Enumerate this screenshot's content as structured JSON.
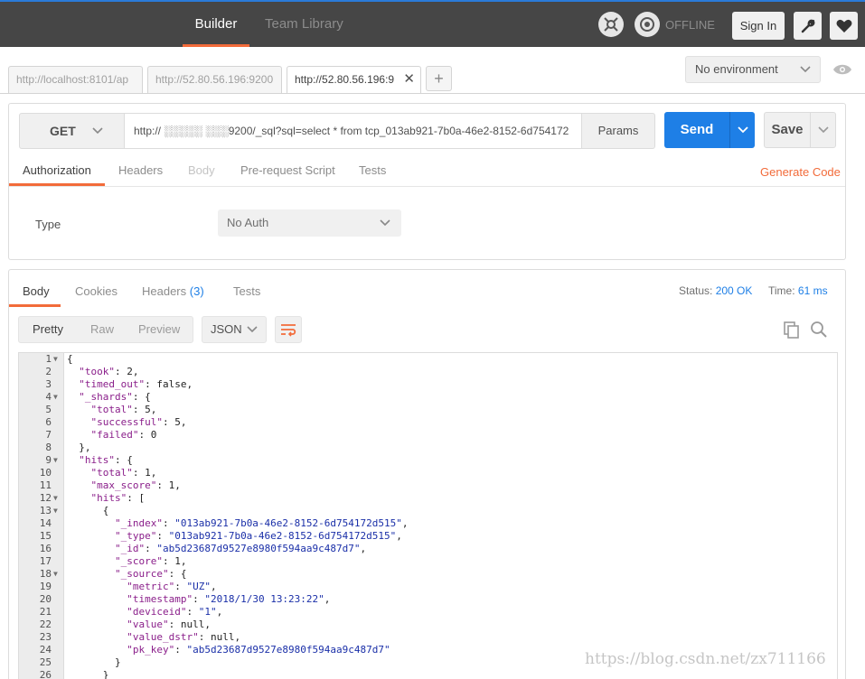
{
  "topbar": {
    "builder_label": "Builder",
    "team_library_label": "Team Library",
    "offline_label": "OFFLINE",
    "signin_label": "Sign In",
    "icons": [
      "sync-icon",
      "status-icon",
      "wrench-icon",
      "heart-icon"
    ]
  },
  "tabs": [
    {
      "label": "http://localhost:8101/ap"
    },
    {
      "label": "http://52.80.56.196:9200"
    },
    {
      "label": "http://52.80.56.196:9",
      "active": true
    }
  ],
  "add_tab_label": "+",
  "environment": {
    "label": "No environment"
  },
  "request": {
    "method": "GET",
    "url": "http:// ░░░░░ ░░░9200/_sql?sql=select * from tcp_013ab921-7b0a-46e2-8152-6d754172",
    "params_label": "Params",
    "send_label": "Send",
    "save_label": "Save",
    "subtabs": [
      "Authorization",
      "Headers",
      "Body",
      "Pre-request Script",
      "Tests"
    ],
    "generate_code_label": "Generate Code",
    "type_label": "Type",
    "auth_value": "No Auth"
  },
  "response": {
    "tabs": {
      "body": "Body",
      "cookies": "Cookies",
      "headers": "Headers",
      "headers_count": "(3)",
      "tests": "Tests"
    },
    "status_label": "Status:",
    "status_value": "200 OK",
    "time_label": "Time:",
    "time_value": "61 ms",
    "format_buttons": [
      "Pretty",
      "Raw",
      "Preview"
    ],
    "language": "JSON"
  },
  "code_lines": [
    {
      "n": "1",
      "fold": true,
      "t": "{"
    },
    {
      "n": "2",
      "t": "  \"took\": 2,"
    },
    {
      "n": "3",
      "t": "  \"timed_out\": false,"
    },
    {
      "n": "4",
      "fold": true,
      "t": "  \"_shards\": {"
    },
    {
      "n": "5",
      "t": "    \"total\": 5,"
    },
    {
      "n": "6",
      "t": "    \"successful\": 5,"
    },
    {
      "n": "7",
      "t": "    \"failed\": 0"
    },
    {
      "n": "8",
      "t": "  },"
    },
    {
      "n": "9",
      "fold": true,
      "t": "  \"hits\": {"
    },
    {
      "n": "10",
      "t": "    \"total\": 1,"
    },
    {
      "n": "11",
      "t": "    \"max_score\": 1,"
    },
    {
      "n": "12",
      "fold": true,
      "t": "    \"hits\": ["
    },
    {
      "n": "13",
      "fold": true,
      "t": "      {"
    },
    {
      "n": "14",
      "t": "        \"_index\": \"013ab921-7b0a-46e2-8152-6d754172d515\","
    },
    {
      "n": "15",
      "t": "        \"_type\": \"013ab921-7b0a-46e2-8152-6d754172d515\","
    },
    {
      "n": "16",
      "t": "        \"_id\": \"ab5d23687d9527e8980f594aa9c487d7\","
    },
    {
      "n": "17",
      "t": "        \"_score\": 1,"
    },
    {
      "n": "18",
      "fold": true,
      "t": "        \"_source\": {"
    },
    {
      "n": "19",
      "t": "          \"metric\": \"UZ\","
    },
    {
      "n": "20",
      "t": "          \"timestamp\": \"2018/1/30 13:23:22\","
    },
    {
      "n": "21",
      "t": "          \"deviceid\": \"1\","
    },
    {
      "n": "22",
      "t": "          \"value\": null,"
    },
    {
      "n": "23",
      "t": "          \"value_dstr\": null,"
    },
    {
      "n": "24",
      "t": "          \"pk_key\": \"ab5d23687d9527e8980f594aa9c487d7\""
    },
    {
      "n": "25",
      "t": "        }"
    },
    {
      "n": "26",
      "t": "      }"
    }
  ],
  "watermark": "https://blog.csdn.net/zx711166",
  "colors": {
    "accent": "#f26b3a",
    "primary": "#1e7fe6",
    "topbar": "#464646"
  }
}
